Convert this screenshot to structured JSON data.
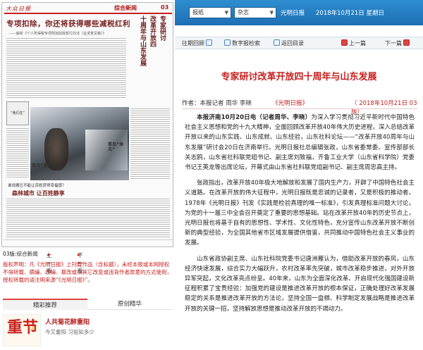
{
  "left": {
    "thumbnail": {
      "masthead_logo": "大众日报",
      "page_name": "综合新闻",
      "page_number": "03",
      "headline_main": "专项扣除，你还将获得哪些减税红利",
      "headline_sub": "——解析《个人所得税专项附加扣除暂行办法（征求意见稿）》",
      "vertical_headline": [
        "专家研讨",
        "改革开放四",
        "十周年与山东发展"
      ],
      "box_ad": "“我们在”",
      "caption_photo": "青岛“渔夫”",
      "caption_small": "谁说搬迁不能让百姓获得幸福感？",
      "headline_bottom": "森林城市 让百姓静享",
      "side_headline": "青岛“渔夫”"
    },
    "page_nav": {
      "page_label": "03版:综合新闻",
      "prev": "上一版",
      "next": "下一版"
    },
    "copyright_text": "版权声明：凡《光明日报》上刊载作品（含标题），未经本报或本网授权不得转载、摘编、改编、篡改或以其它改变或违背作者原意的方式使用，授权转载的请注明来源“《光明日报》”。",
    "recommend": {
      "tabs": [
        "精彩推荐",
        "原创精华"
      ],
      "card": {
        "thumb_big": "重节",
        "thumb_small": "九月",
        "title": "人共菊花醉重阳",
        "meta": "今又重阳 习俗知多少"
      }
    }
  },
  "right": {
    "topbar": {
      "select_1": "报纸",
      "select_2": "杂志",
      "daily_link": "光明日报",
      "date": "2018年10月21日 星期日"
    },
    "toolbar": {
      "items": [
        "往期回顾",
        "数字报检索",
        "返回目录"
      ],
      "prev": "上一篇",
      "next": "下一篇"
    },
    "article": {
      "title": "专家研讨改革开放四十周年与山东发展",
      "byline": "作者：本报记者 周华 李晓",
      "source": "《光明日报》",
      "pubdate": "（ 2018年10月21日 03版）",
      "lead_bold": "本报济南10月20日电（记者周华、李晓）",
      "paragraphs": [
        "为深入学习贯彻习近平新时代中国特色社会主义思想和党的十九大精神，全面回顾改革开放40年伟大历史进程，深入总结改革开放以来的山东实践、山东成就、山东经验，山东社科论坛——“改革开放40周年与山东发展”研讨会20日在济南举行。光明日报社总编辑张政，山东省委常委、宣传部部长关志鸥，山东省社科联党组书记、副主席刘致福，齐鲁工业大学（山东省科学院）党委书记王英龙等出席论坛，开幕式由山东省社科联党组副书记、副主席周忠高主持。",
        "张政指出，改革开放40年极大地解放和发展了国内生产力，开辟了中国特色社会主义道路。在改革开放的伟大征程中，光明日报既是忠诚的记录者，又是积极的推动者。1978年《光明日报》刊发《实践是检验真理的唯一标准》，引发真理标准问题大讨论，为党的十一届三中全会召开奠定了重要的思想基础。站在改革开放40年的历史节点上，光明日报也将基于自有的思想性、学术性、文化性特色，充分宣传山东改革开放不断创新的典型经验，为全国其他省市区域发展提供借鉴，共同推动中国特色社会主义事业的发展。",
        "山东省政协副主席、山东社科院党委书记唐洲雁认为，借助改革开放的春风，山东经济快速发展，综合实力大幅跃升，农村改革率先突破，城市改革稳步推进，对外开放异军突起，文化改革亮点纷呈。40年来，山东为全面深化改革、开启现代化强国建设新征程积累了宝贵经验：加强党的建设是推进改革开放的根本保证，正确处理好改革发展稳定的关系是推进改革开放的方法论，坚持全国一盘棋、科学制定发展战略是推进改革开放的关键一招，坚持解放思想是推动改革开放的不竭动力。"
      ]
    }
  }
}
